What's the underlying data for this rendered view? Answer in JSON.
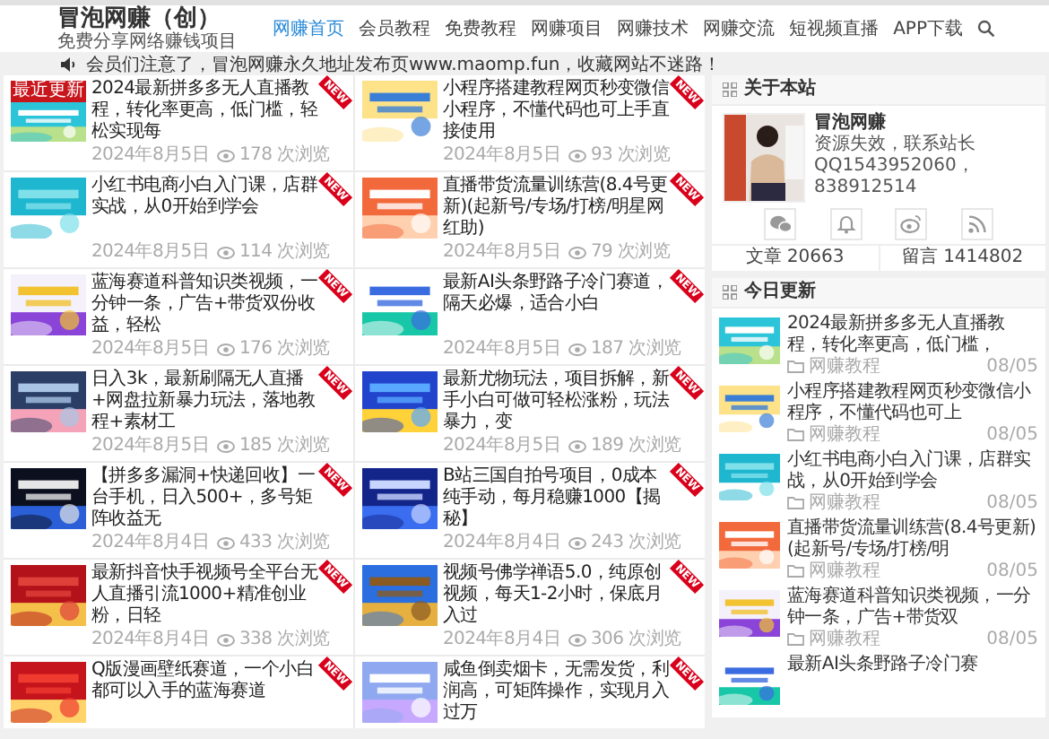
{
  "site": {
    "logo": "冒泡网赚（创）",
    "tagline": "免费分享网络赚钱项目"
  },
  "nav": [
    {
      "label": "网赚首页",
      "selected": true
    },
    {
      "label": "会员教程",
      "selected": false
    },
    {
      "label": "免费教程",
      "selected": false
    },
    {
      "label": "网赚项目",
      "selected": false
    },
    {
      "label": "网赚技术",
      "selected": false
    },
    {
      "label": "网赚交流",
      "selected": false
    },
    {
      "label": "短视频直播",
      "selected": false
    },
    {
      "label": "APP下载",
      "selected": false
    }
  ],
  "notice": "会员们注意了，冒泡网赚永久地址发布页www.maomp.fun，收藏网站不迷路！",
  "posts": [
    {
      "title": "2024最新拼多多无人直播教程，转化率更高，低门槛，轻松实现每",
      "date": "2024年8月5日",
      "views": "178 次浏览",
      "ribbon": "NEW",
      "badge": "最近更新"
    },
    {
      "title": "小程序搭建教程网页秒变微信小程序，不懂代码也可上手直接使用",
      "date": "2024年8月5日",
      "views": "93 次浏览",
      "ribbon": "NEW"
    },
    {
      "title": "小红书电商小白入门课，店群实战，从0开始到学会",
      "date": "2024年8月5日",
      "views": "114 次浏览",
      "ribbon": "NEW"
    },
    {
      "title": "直播带货流量训练营(8.4号更新)(起新号/专场/打榜/明星网红助)",
      "date": "2024年8月5日",
      "views": "79 次浏览",
      "ribbon": "NEW"
    },
    {
      "title": "蓝海赛道科普知识类视频，一分钟一条，广告+带货双份收益，轻松",
      "date": "2024年8月5日",
      "views": "176 次浏览",
      "ribbon": "NEW"
    },
    {
      "title": "最新AI头条野路子冷门赛道，隔天必爆，适合小白",
      "date": "2024年8月5日",
      "views": "187 次浏览",
      "ribbon": "NEW"
    },
    {
      "title": "日入3k，最新刷隔无人直播+网盘拉新暴力玩法，落地教程+素材工",
      "date": "2024年8月5日",
      "views": "185 次浏览",
      "ribbon": "NEW"
    },
    {
      "title": "最新尤物玩法，项目拆解，新手小白可做可轻松涨粉，玩法暴力，变",
      "date": "2024年8月5日",
      "views": "189 次浏览",
      "ribbon": "NEW"
    },
    {
      "title": "【拼多多漏洞+快递回收】一台手机，日入500+，多号矩阵收益无",
      "date": "2024年8月4日",
      "views": "433 次浏览",
      "ribbon": "NEW"
    },
    {
      "title": "B站三国自拍号项目，0成本纯手动，每月稳赚1000【揭秘】",
      "date": "2024年8月4日",
      "views": "243 次浏览",
      "ribbon": "NEW"
    },
    {
      "title": "最新抖音快手视频号全平台无人直播引流1000+精准创业粉，日轻",
      "date": "2024年8月4日",
      "views": "338 次浏览",
      "ribbon": "NEW"
    },
    {
      "title": "视频号佛学禅语5.0，纯原创视频，每天1-2小时，保底月入过",
      "date": "2024年8月4日",
      "views": "306 次浏览",
      "ribbon": "NEW"
    },
    {
      "title": "Q版漫画壁纸赛道，一个小白都可以入手的蓝海赛道",
      "ribbon": "NEW"
    },
    {
      "title": "咸鱼倒卖烟卡，无需发货，利润高，可矩阵操作，实现月入过万",
      "ribbon": "NEW"
    }
  ],
  "about": {
    "title": "关于本站",
    "name": "冒泡网赚",
    "lines": [
      "资源失效，联系站长",
      "QQ1543952060，",
      "838912514"
    ],
    "stats": [
      "文章 20663",
      "留言 1414802"
    ]
  },
  "today": {
    "title": "今日更新",
    "items": [
      {
        "title": "2024最新拼多多无人直播教程，转化率更高，低门槛，",
        "category": "网赚教程",
        "date": "08/05"
      },
      {
        "title": "小程序搭建教程网页秒变微信小程序，不懂代码也可上",
        "category": "网赚教程",
        "date": "08/05"
      },
      {
        "title": "小红书电商小白入门课，店群实战，从0开始到学会",
        "category": "网赚教程",
        "date": "08/05"
      },
      {
        "title": "直播带货流量训练营(8.4号更新)(起新号/专场/打榜/明",
        "category": "网赚教程",
        "date": "08/05"
      },
      {
        "title": "蓝海赛道科普知识类视频，一分钟一条，广告+带货双",
        "category": "网赚教程",
        "date": "08/05"
      },
      {
        "title": "最新AI头条野路子冷门赛"
      }
    ]
  }
}
